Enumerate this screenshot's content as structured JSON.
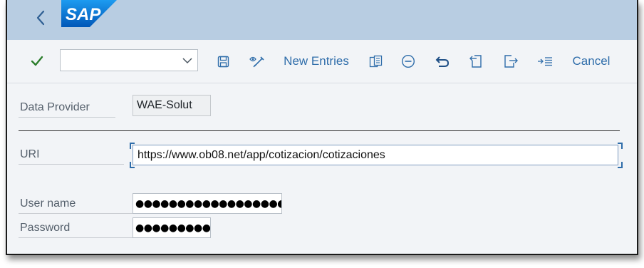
{
  "header": {
    "back_icon": "chevron-left-icon",
    "logo_text": "SAP",
    "logo_color": "#0a6ed1"
  },
  "toolbar": {
    "confirm_icon": "checkmark-icon",
    "command_field": {
      "value": "",
      "placeholder": ""
    },
    "save_icon": "save-icon",
    "edit_icon": "display-change-icon",
    "new_entries_label": "New Entries",
    "copy_icon": "copy-icon",
    "delete_icon": "delete-icon",
    "undo_icon": "undo-icon",
    "previous_entry_icon": "previous-entry-icon",
    "next_entry_icon": "next-entry-icon",
    "select_block_icon": "select-block-icon",
    "cancel_label": "Cancel"
  },
  "form": {
    "data_provider": {
      "label": "Data Provider",
      "value": "WAE-Solut"
    },
    "uri": {
      "label": "URI",
      "value": "https://www.ob08.net/app/cotizacion/cotizaciones"
    },
    "user_name": {
      "label": "User name",
      "value": "●●●●●●●●●●●●●●●●●●●●●●●"
    },
    "password": {
      "label": "Password",
      "value": "●●●●●●●●●●●●●"
    }
  },
  "colors": {
    "shell_bg": "#b8cde2",
    "accent": "#2f6daa",
    "confirm": "#2b7d2b",
    "page_bg": "#f2f4f7"
  }
}
